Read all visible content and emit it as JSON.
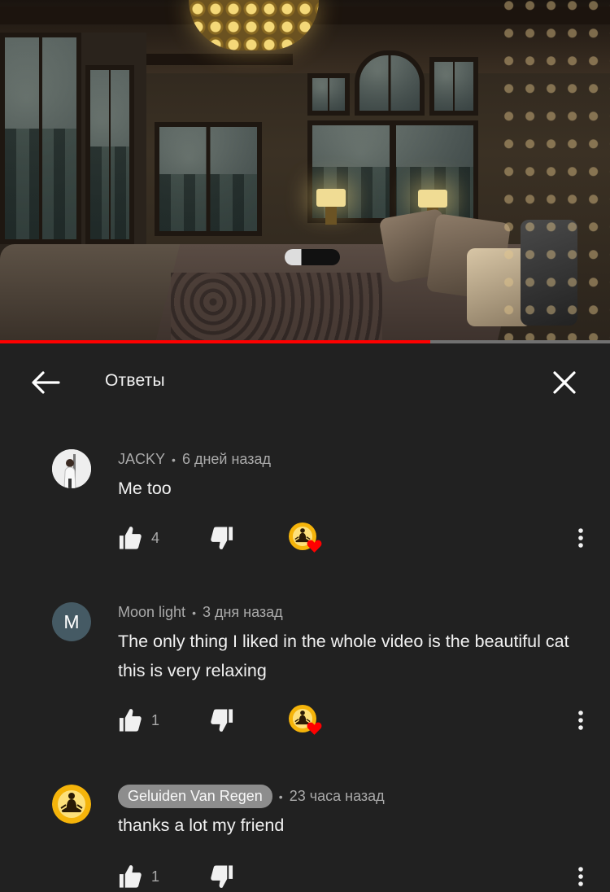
{
  "video": {
    "progress_fraction": 0.705
  },
  "header": {
    "title": "Ответы"
  },
  "colors": {
    "accent": "#ff0000",
    "background": "#212121",
    "secondary_text": "#aaaaaa"
  },
  "comments": [
    {
      "author": "JACKY",
      "separator": "•",
      "time": "6 дней назад",
      "text": "Me too",
      "likes": "4",
      "avatar_letter": "",
      "avatar_icon": "person-photo-icon",
      "hearted_by_creator": true,
      "author_is_creator": false
    },
    {
      "author": "Moon light",
      "separator": "•",
      "time": "3 дня назад",
      "text": "The only thing I liked in the whole video is the beautiful cat this is very relaxing",
      "likes": "1",
      "avatar_letter": "M",
      "avatar_icon": "letter-avatar",
      "hearted_by_creator": true,
      "author_is_creator": false
    },
    {
      "author": "Geluiden Van Regen",
      "separator": "•",
      "time": "23 часа назад",
      "text": "thanks a lot my friend",
      "likes": "1",
      "avatar_letter": "",
      "avatar_icon": "meditation-icon",
      "hearted_by_creator": false,
      "author_is_creator": true
    }
  ]
}
